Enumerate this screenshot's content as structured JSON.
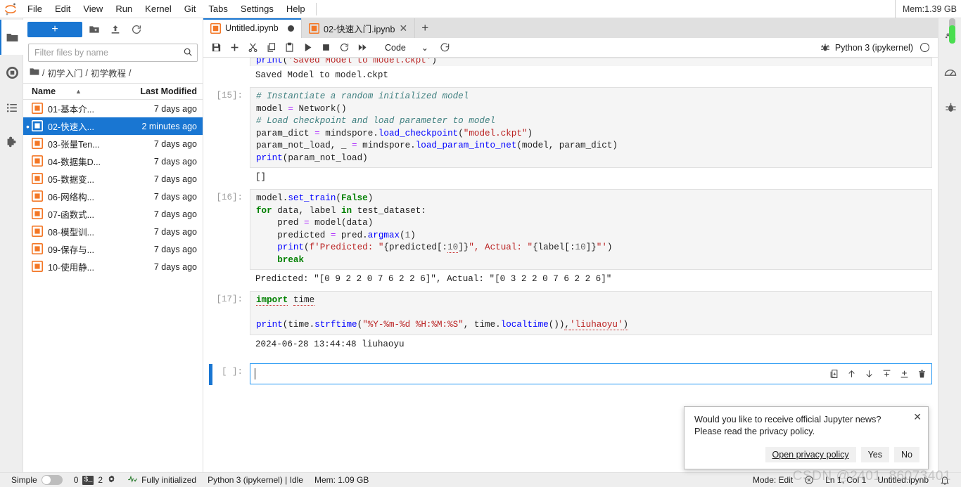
{
  "window": {
    "mem_top": "Mem:1.39 GB"
  },
  "menubar": {
    "logo": "jupyter-logo",
    "items": [
      {
        "label": "File"
      },
      {
        "label": "Edit"
      },
      {
        "label": "View"
      },
      {
        "label": "Run"
      },
      {
        "label": "Kernel"
      },
      {
        "label": "Git"
      },
      {
        "label": "Tabs"
      },
      {
        "label": "Settings"
      },
      {
        "label": "Help"
      }
    ]
  },
  "activity_bar": {
    "items": [
      {
        "name": "file-browser",
        "icon": "folder-icon",
        "active": true
      },
      {
        "name": "running-sessions",
        "icon": "stop-circle-icon",
        "active": false
      },
      {
        "name": "table-of-contents",
        "icon": "list-icon",
        "active": false
      },
      {
        "name": "extension-manager",
        "icon": "puzzle-icon",
        "active": false
      }
    ]
  },
  "right_bar": {
    "items": [
      {
        "name": "property-inspector",
        "icon": "gears-icon"
      },
      {
        "name": "dashboard",
        "icon": "gauge-icon"
      },
      {
        "name": "debugger",
        "icon": "bug-icon"
      }
    ]
  },
  "file_browser": {
    "new_launcher_label": "+",
    "toolbar_icons": [
      "new-folder-icon",
      "upload-icon",
      "refresh-icon"
    ],
    "filter": {
      "placeholder": "Filter files by name",
      "value": "",
      "icon": "search-icon"
    },
    "breadcrumb": {
      "root_icon": "folder-icon",
      "parts": [
        "/",
        "初学入门",
        "/",
        "初学教程",
        "/"
      ]
    },
    "columns": {
      "name": "Name",
      "last_modified": "Last Modified",
      "sort_indicator": "▲"
    },
    "files": [
      {
        "name": "01-基本介...",
        "modified": "7 days ago",
        "selected": false,
        "running": false
      },
      {
        "name": "02-快速入...",
        "modified": "2 minutes ago",
        "selected": true,
        "running": true
      },
      {
        "name": "03-张量Ten...",
        "modified": "7 days ago",
        "selected": false,
        "running": false
      },
      {
        "name": "04-数据集D...",
        "modified": "7 days ago",
        "selected": false,
        "running": false
      },
      {
        "name": "05-数据变...",
        "modified": "7 days ago",
        "selected": false,
        "running": false
      },
      {
        "name": "06-网络构...",
        "modified": "7 days ago",
        "selected": false,
        "running": false
      },
      {
        "name": "07-函数式...",
        "modified": "7 days ago",
        "selected": false,
        "running": false
      },
      {
        "name": "08-模型训...",
        "modified": "7 days ago",
        "selected": false,
        "running": false
      },
      {
        "name": "09-保存与...",
        "modified": "7 days ago",
        "selected": false,
        "running": false
      },
      {
        "name": "10-使用静...",
        "modified": "7 days ago",
        "selected": false,
        "running": false
      }
    ]
  },
  "tabs": [
    {
      "label": "Untitled.ipynb",
      "active": true,
      "dirty": true,
      "closable": false
    },
    {
      "label": "02-快速入门.ipynb",
      "active": false,
      "dirty": false,
      "closable": true
    }
  ],
  "tab_add_label": "+",
  "notebook_toolbar": {
    "buttons": [
      {
        "name": "save-button",
        "icon": "save-icon"
      },
      {
        "name": "insert-cell-button",
        "icon": "plus-icon"
      },
      {
        "name": "cut-cell-button",
        "icon": "scissors-icon"
      },
      {
        "name": "copy-cell-button",
        "icon": "copy-icon"
      },
      {
        "name": "paste-cell-button",
        "icon": "paste-icon"
      },
      {
        "name": "run-cell-button",
        "icon": "play-icon"
      },
      {
        "name": "interrupt-kernel-button",
        "icon": "stop-icon"
      },
      {
        "name": "restart-kernel-button",
        "icon": "restart-icon"
      },
      {
        "name": "restart-run-all-button",
        "icon": "fast-forward-icon"
      }
    ],
    "cell_type": "Code",
    "cell_type_chevron": "⌄",
    "git_icon": "git-clone-icon",
    "debugger_icon": "bug-icon",
    "kernel_name": "Python 3 (ipykernel)",
    "kernel_status_icon": "idle-circle-icon"
  },
  "notebook": {
    "cells": [
      {
        "type": "output-tail",
        "prompt": "",
        "clipped_code": "print('Saved Model to model.ckpt')",
        "output": "Saved Model to model.ckpt"
      },
      {
        "type": "code",
        "prompt": "[15]:",
        "lines": [
          "# Instantiate a random initialized model",
          "model = Network()",
          "# Load checkpoint and load parameter to model",
          "param_dict = mindspore.load_checkpoint(\"model.ckpt\")",
          "param_not_load, _ = mindspore.load_param_into_net(model, param_dict)",
          "print(param_not_load)"
        ],
        "output": "[]"
      },
      {
        "type": "code",
        "prompt": "[16]:",
        "lines": [
          "model.set_train(False)",
          "for data, label in test_dataset:",
          "    pred = model(data)",
          "    predicted = pred.argmax(1)",
          "    print(f'Predicted: \"{predicted[:10]}\", Actual: \"{label[:10]}\"')",
          "    break"
        ],
        "output": "Predicted: \"[0 9 2 2 0 7 6 2 2 6]\", Actual: \"[0 3 2 2 0 7 6 2 2 6]\""
      },
      {
        "type": "code",
        "prompt": "[17]:",
        "lines": [
          "import time",
          "",
          "print(time.strftime(\"%Y-%m-%d %H:%M:%S\", time.localtime()),'liuhaoyu')"
        ],
        "output": "2024-06-28 13:44:48 liuhaoyu"
      },
      {
        "type": "active-empty",
        "prompt": "[ ]:",
        "value": "",
        "toolbar": [
          {
            "name": "duplicate-cell-button",
            "icon": "duplicate-icon"
          },
          {
            "name": "move-cell-up-button",
            "icon": "arrow-up-icon"
          },
          {
            "name": "move-cell-down-button",
            "icon": "arrow-down-icon"
          },
          {
            "name": "insert-cell-above-button",
            "icon": "insert-above-icon"
          },
          {
            "name": "insert-cell-below-button",
            "icon": "insert-below-icon"
          },
          {
            "name": "delete-cell-button",
            "icon": "trash-icon"
          }
        ]
      }
    ]
  },
  "notification": {
    "message_line1": "Would you like to receive official Jupyter news?",
    "message_line2": "Please read the privacy policy.",
    "close_icon": "close-icon",
    "actions": [
      {
        "label": "Open privacy policy",
        "style": "link"
      },
      {
        "label": "Yes",
        "style": "plain"
      },
      {
        "label": "No",
        "style": "plain"
      }
    ]
  },
  "status_bar": {
    "simple_label": "Simple",
    "simple_toggle_on": false,
    "kernel_count": "0",
    "terminal_badge": "$_",
    "terminal_count": "2",
    "settings_icon": "gear-icon",
    "init_icon": "check-activity-icon",
    "init_text": "Fully initialized",
    "kernel_status": "Python 3 (ipykernel) | Idle",
    "memory": "Mem: 1.09 GB",
    "mode": "Mode: Edit",
    "no-kernel-icon": "circle-x-icon",
    "cursor_position": "Ln 1, Col 1",
    "document_name": "Untitled.ipynb",
    "notification_icon": "bell-icon"
  },
  "watermark": "CSDN @2401_86073401",
  "colors": {
    "accent": "#1976d2",
    "selection": "#1976d2",
    "toolbar_bg": "#eeeeee",
    "code_bg": "#f5f5f5",
    "notebook_icon": "#f37726",
    "memory_gauge": "#4ade50"
  }
}
